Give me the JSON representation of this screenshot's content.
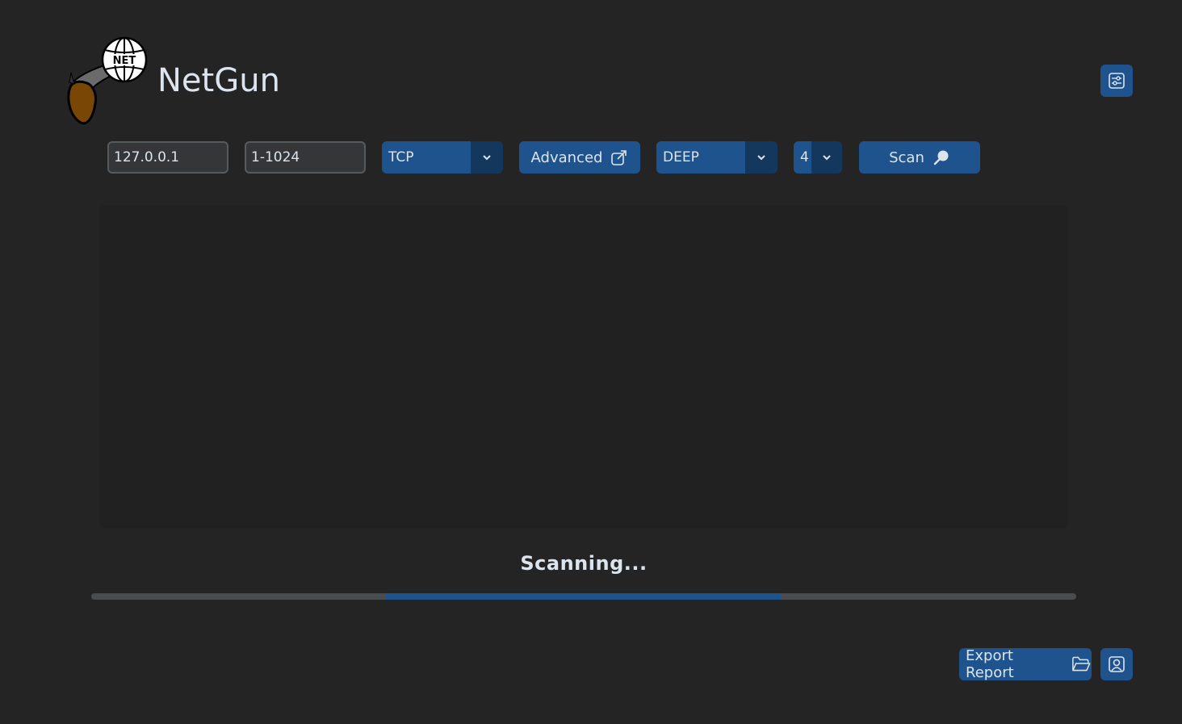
{
  "app": {
    "title": "NetGun"
  },
  "toolbar": {
    "target_input": {
      "value": "127.0.0.1",
      "placeholder": ""
    },
    "ports_input": {
      "value": "1-1024",
      "placeholder": ""
    },
    "protocol_select": {
      "selected": "TCP"
    },
    "advanced_button": {
      "label": "Advanced",
      "icon": "external-link-icon"
    },
    "mode_select": {
      "selected": "DEEP"
    },
    "threads_select": {
      "selected": "4"
    },
    "scan_button": {
      "label": "Scan",
      "icon": "search-icon"
    }
  },
  "output": {
    "text": ""
  },
  "status": {
    "text": "Scanning...",
    "progress": {
      "indeterminate": true,
      "segment_start": 0.298,
      "segment_end": 0.7
    }
  },
  "footer": {
    "export_button": {
      "label": "Export Report",
      "icon": "folder-icon"
    },
    "profile_button": {
      "icon": "user-icon"
    }
  },
  "header": {
    "settings_button": {
      "icon": "sliders-icon"
    }
  },
  "colors": {
    "background": "#242424",
    "accent": "#1f538d",
    "accent_dark": "#14375e",
    "entry_bg": "#343638",
    "entry_border": "#565b5e",
    "output_bg": "#212121",
    "text": "#dce4ee",
    "progress_track": "#4a4d50"
  }
}
